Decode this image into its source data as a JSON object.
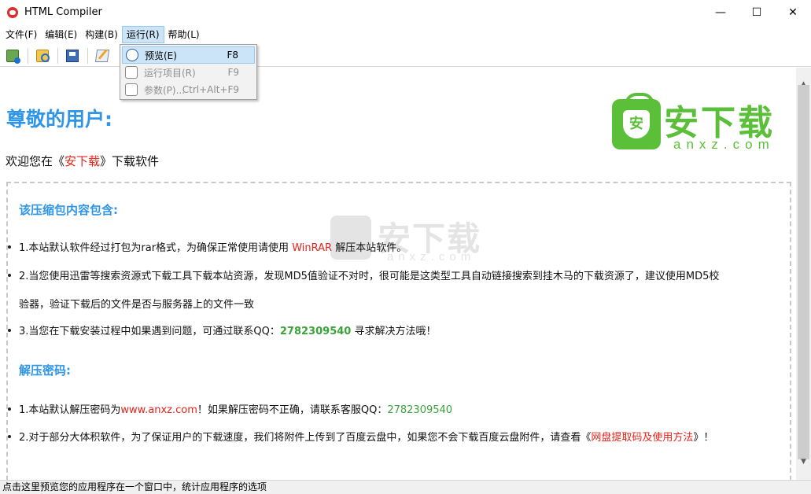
{
  "window": {
    "title": "HTML Compiler",
    "minimize": "—",
    "maximize": "☐",
    "close": "✕"
  },
  "menubar": {
    "items": [
      "文件(F)",
      "编辑(E)",
      "构建(B)",
      "运行(R)",
      "帮助(L)"
    ]
  },
  "toolbar": {
    "buttons": [
      "new-project-icon",
      "open-icon",
      "save-icon",
      "edit-icon"
    ]
  },
  "run_menu": {
    "items": [
      {
        "label": "预览(E)",
        "shortcut": "F8",
        "enabled": true,
        "highlighted": true
      },
      {
        "label": "运行项目(R)",
        "shortcut": "F9",
        "enabled": false
      },
      {
        "label": "参数(P)...",
        "shortcut": "Ctrl+Alt+F9",
        "enabled": false
      }
    ]
  },
  "content": {
    "greeting": "尊敬的用户:",
    "welcome_pre": "欢迎您在《",
    "welcome_site": "安下载",
    "welcome_post": "》下载软件",
    "logo_cn": "安下载",
    "logo_en": "anxz.com",
    "logo_badge": "安",
    "section1_title": "该压缩包内容包含:",
    "s1_item1_pre": "1.本站默认软件经过打包为rar格式，为确保正常使用请使用 ",
    "s1_item1_red": "WinRAR",
    "s1_item1_post": " 解压本站软件。",
    "s1_item2_line1": "2.当您使用迅雷等搜索资源式下载工具下载本站资源，发现MD5值验证不对时，很可能是这类型工具自动链接搜索到挂木马的下载资源了，建议使用MD5校",
    "s1_item2_line2": "验器，验证下载后的文件是否与服务器上的文件一致",
    "s1_item3_pre": "3.当您在下载安装过程中如果遇到问题，可通过联系QQ：",
    "s1_item3_qq": "2782309540",
    "s1_item3_post": " 寻求解决方法哦！",
    "section2_title": "解压密码:",
    "s2_item1_pre": "1.本站默认解压密码为",
    "s2_item1_url": "www.anxz.com",
    "s2_item1_mid": "！如果解压密码不正确，请联系客服QQ：",
    "s2_item1_qq": "2782309540",
    "s2_item2_pre": "2.对于部分大体积软件，为了保证用户的下载速度，我们将附件上传到了百度云盘中，如果您不会下载百度云盘附件，请查看《",
    "s2_item2_link": "网盘提取码及使用方法",
    "s2_item2_post": "》！"
  },
  "statusbar": {
    "text": "点击这里预览您的应用程序在一个窗口中，统计应用程序的选项"
  },
  "colors": {
    "heading_blue": "#2f95e6",
    "red": "#e6231a",
    "green": "#3aa33a",
    "logo_green": "#5bbf3a"
  }
}
